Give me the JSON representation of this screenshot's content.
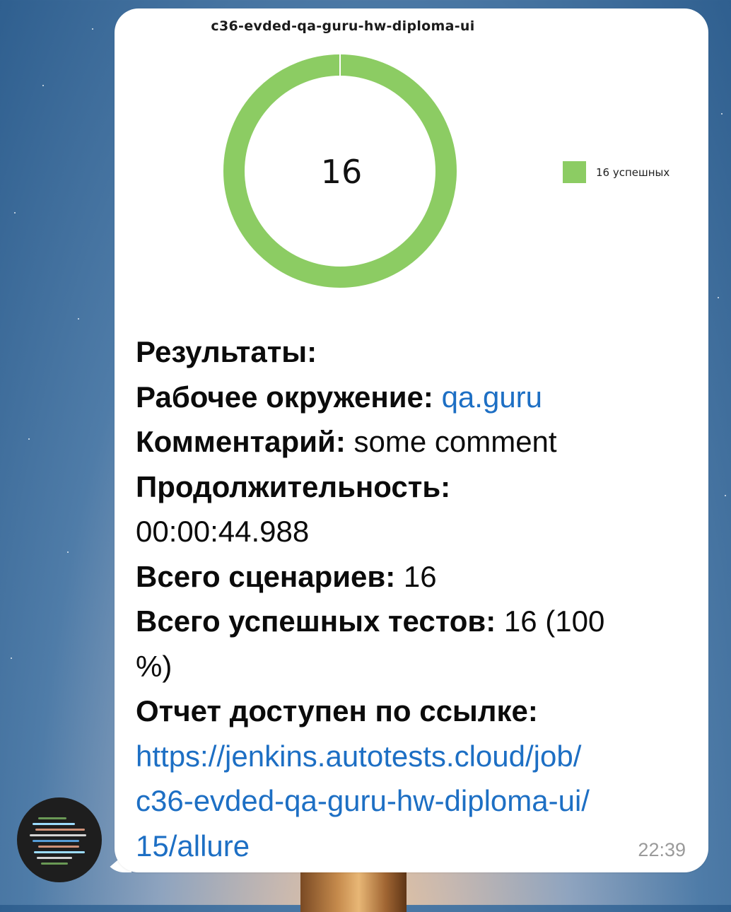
{
  "chart": {
    "title": "c36-evded-qa-guru-hw-diploma-ui",
    "center_value": "16",
    "legend_label": "16 успешных",
    "color": "#8ccc63"
  },
  "chart_data": {
    "type": "pie",
    "title": "c36-evded-qa-guru-hw-diploma-ui",
    "categories": [
      "16 успешных"
    ],
    "values": [
      16
    ],
    "legend": "right"
  },
  "message": {
    "results_label": "Результаты:",
    "env_label": "Рабочее окружение:",
    "env_value": "qa.guru",
    "comment_label": "Комментарий:",
    "comment_value": "some comment",
    "duration_label": "Продолжительность:",
    "duration_value": "00:00:44.988",
    "scenarios_label": "Всего сценариев:",
    "scenarios_value": "16",
    "passed_label": "Всего успешных тестов:",
    "passed_value": "16 (100",
    "passed_value_cont": "%)",
    "report_label": "Отчет доступен по ссылке:",
    "report_link_1": "https://jenkins.autotests.cloud/job/",
    "report_link_2": "c36-evded-qa-guru-hw-diploma-ui/",
    "report_link_3": "15/allure",
    "time": "22:39"
  },
  "colors": {
    "link": "#1d6fc4",
    "donut": "#8ccc63"
  }
}
